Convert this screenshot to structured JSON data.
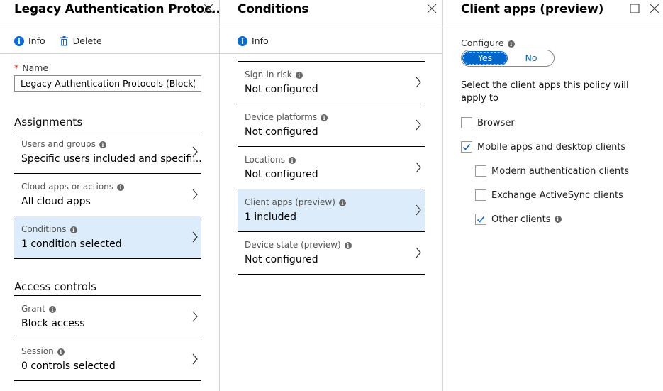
{
  "policy_blade": {
    "title": "Legacy Authentication Protoc...",
    "commands": [
      {
        "label": "Info",
        "icon": "info-icon"
      },
      {
        "label": "Delete",
        "icon": "trash-icon"
      }
    ],
    "name_label": "Name",
    "name_required_marker": "*",
    "name_value": "Legacy Authentication Protocols (Block)",
    "assignments": {
      "title": "Assignments",
      "items": [
        {
          "label": "Users and groups",
          "value": "Specific users included and specifi...",
          "selected": false
        },
        {
          "label": "Cloud apps or actions",
          "value": "All cloud apps",
          "selected": false
        },
        {
          "label": "Conditions",
          "value": "1 condition selected",
          "selected": true
        }
      ]
    },
    "access_controls": {
      "title": "Access controls",
      "items": [
        {
          "label": "Grant",
          "value": "Block access",
          "selected": false
        },
        {
          "label": "Session",
          "value": "0 controls selected",
          "selected": false
        }
      ]
    }
  },
  "conditions_blade": {
    "title": "Conditions",
    "commands": [
      {
        "label": "Info",
        "icon": "info-icon"
      }
    ],
    "items": [
      {
        "label": "Sign-in risk",
        "value": "Not configured",
        "selected": false
      },
      {
        "label": "Device platforms",
        "value": "Not configured",
        "selected": false
      },
      {
        "label": "Locations",
        "value": "Not configured",
        "selected": false
      },
      {
        "label": "Client apps (preview)",
        "value": "1 included",
        "selected": true
      },
      {
        "label": "Device state (preview)",
        "value": "Not configured",
        "selected": false
      }
    ]
  },
  "client_apps_blade": {
    "title": "Client apps (preview)",
    "configure_label": "Configure",
    "toggle": {
      "options": [
        "Yes",
        "No"
      ],
      "selected": "Yes"
    },
    "description": "Select the client apps this policy will apply to",
    "checkboxes": [
      {
        "label": "Browser",
        "checked": false,
        "level": 0,
        "info": false
      },
      {
        "label": "Mobile apps and desktop clients",
        "checked": true,
        "level": 0,
        "info": false
      },
      {
        "label": "Modern authentication clients",
        "checked": false,
        "level": 1,
        "info": false
      },
      {
        "label": "Exchange ActiveSync clients",
        "checked": false,
        "level": 1,
        "info": false
      },
      {
        "label": "Other clients",
        "checked": true,
        "level": 1,
        "info": true
      }
    ]
  },
  "colors": {
    "accent": "#0066cc",
    "selected_row": "#dcecfa",
    "required": "#dd0000"
  }
}
